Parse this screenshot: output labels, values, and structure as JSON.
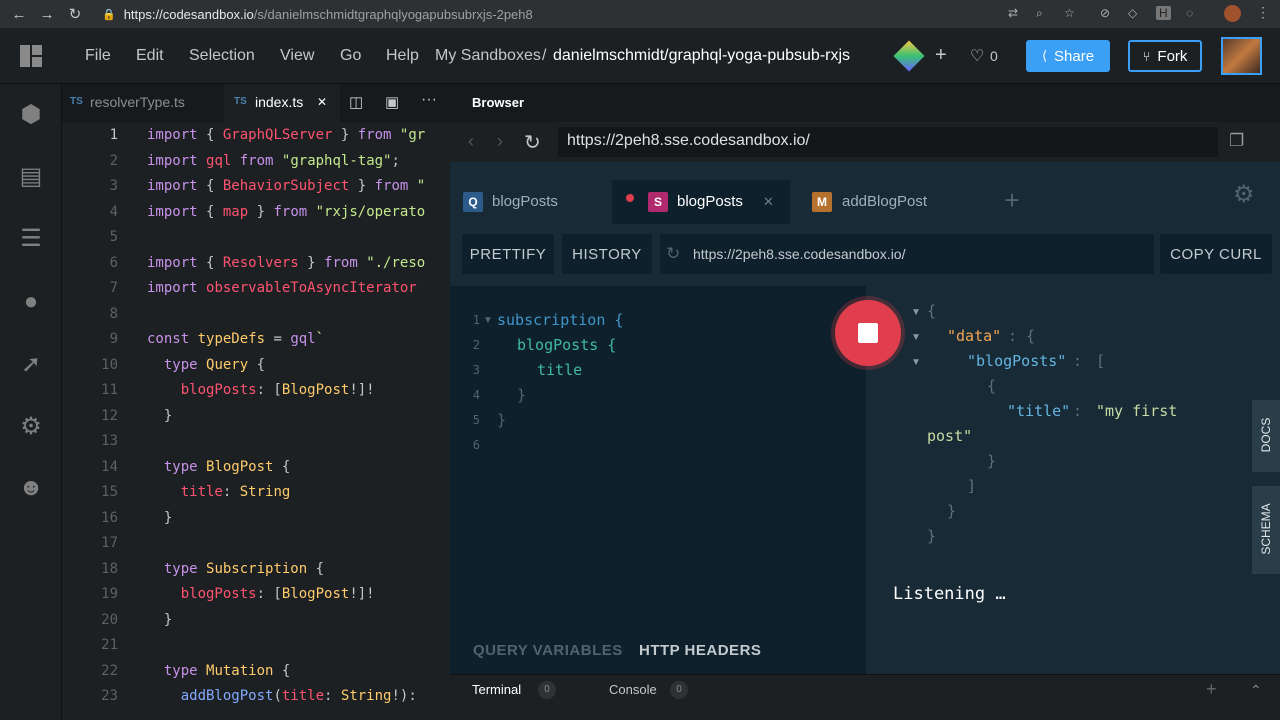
{
  "browser_chrome": {
    "url_host": "https://codesandbox.io",
    "url_path": "/s/danielmschmidtgraphqlyogapubsubrxjs-2peh8"
  },
  "menu": [
    "File",
    "Edit",
    "Selection",
    "View",
    "Go",
    "Help"
  ],
  "breadcrumb": {
    "parent": "My Sandboxes",
    "separator": "/",
    "current": "danielmschmidt/graphql-yoga-pubsub-rxjs"
  },
  "header": {
    "plus": "+",
    "likes": "0",
    "share_label": "Share",
    "fork_label": "Fork"
  },
  "editor": {
    "tabs": [
      {
        "badge": "TS",
        "label": "resolverType.ts"
      },
      {
        "badge": "TS",
        "label": "index.ts",
        "close": "✕"
      }
    ],
    "lines": [
      "1",
      "2",
      "3",
      "4",
      "5",
      "6",
      "7",
      "8",
      "9",
      "10",
      "11",
      "12",
      "13",
      "14",
      "15",
      "16",
      "17",
      "18",
      "19",
      "20",
      "21",
      "22",
      "23"
    ]
  },
  "browser": {
    "tab_title": "Browser",
    "url": "https://2peh8.sse.codesandbox.io/"
  },
  "playground": {
    "tabs": [
      {
        "badge": "Q",
        "label": "blogPosts",
        "color": "#2e5c8a"
      },
      {
        "badge": "S",
        "label": "blogPosts",
        "color": "#b02a6d",
        "close": "✕"
      },
      {
        "badge": "M",
        "label": "addBlogPost",
        "color": "#b5722e"
      }
    ],
    "add_tab": "+",
    "prettify": "PRETTIFY",
    "history": "HISTORY",
    "endpoint": "https://2peh8.sse.codesandbox.io/",
    "copy_curl": "COPY CURL",
    "query_line_numbers": [
      "1",
      "2",
      "3",
      "4",
      "5",
      "6"
    ],
    "query_lines": {
      "l1": "subscription {",
      "l2": "blogPosts {",
      "l3": "title",
      "l4": "}",
      "l5": "}"
    },
    "result": {
      "open": "{",
      "data_key": "\"data\"",
      "blog_key": "\"blogPosts\"",
      "arr_open": "[",
      "obj_open": "{",
      "title_key": "\"title\"",
      "title_val_1": "\"my first",
      "title_val_2": "post\"",
      "obj_close": "}",
      "arr_close": "]",
      "data_close": "}",
      "close": "}"
    },
    "listening": "Listening …",
    "query_variables": "QUERY VARIABLES",
    "http_headers": "HTTP HEADERS",
    "docs": "DOCS",
    "schema": "SCHEMA"
  },
  "bottom": {
    "terminal": "Terminal",
    "terminal_count": "0",
    "console": "Console",
    "console_count": "0",
    "add": "+",
    "collapse": "⌃"
  }
}
